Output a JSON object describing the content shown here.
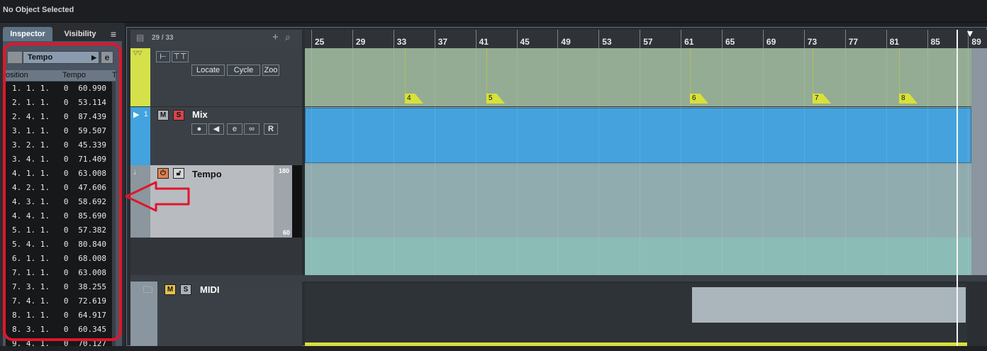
{
  "status_text": "No Object Selected",
  "inspector": {
    "tab_inspector": "Inspector",
    "tab_visibility": "Visibility",
    "menu_icon": "≡",
    "track_select": "Tempo",
    "col_position": "osition",
    "col_tempo": "Tempo",
    "col_extra": "T",
    "rows": [
      {
        "pos": "1. 1. 1.   0",
        "tempo": "60.990"
      },
      {
        "pos": "2. 1. 1.   0",
        "tempo": "53.114"
      },
      {
        "pos": "2. 4. 1.   0",
        "tempo": "87.439"
      },
      {
        "pos": "3. 1. 1.   0",
        "tempo": "59.507"
      },
      {
        "pos": "3. 2. 1.   0",
        "tempo": "45.339"
      },
      {
        "pos": "3. 4. 1.   0",
        "tempo": "71.409"
      },
      {
        "pos": "4. 1. 1.   0",
        "tempo": "63.008"
      },
      {
        "pos": "4. 2. 1.   0",
        "tempo": "47.606"
      },
      {
        "pos": "4. 3. 1.   0",
        "tempo": "58.692"
      },
      {
        "pos": "4. 4. 1.   0",
        "tempo": "85.690"
      },
      {
        "pos": "5. 1. 1.   0",
        "tempo": "57.382"
      },
      {
        "pos": "5. 4. 1.   0",
        "tempo": "80.840"
      },
      {
        "pos": "6. 1. 1.   0",
        "tempo": "68.008"
      },
      {
        "pos": "7. 1. 1.   0",
        "tempo": "63.008"
      },
      {
        "pos": "7. 3. 1.   0",
        "tempo": "38.255"
      },
      {
        "pos": "7. 4. 1.   0",
        "tempo": "72.619"
      },
      {
        "pos": "8. 1. 1.   0",
        "tempo": "64.917"
      },
      {
        "pos": "8. 3. 1.   0",
        "tempo": "60.345"
      },
      {
        "pos": "9. 4. 1.   0",
        "tempo": "70.127"
      }
    ]
  },
  "project": {
    "track_count": "29 / 33",
    "ruler_labels": [
      "25",
      "29",
      "33",
      "37",
      "41",
      "45",
      "49",
      "53",
      "57",
      "61",
      "65",
      "69",
      "73",
      "77",
      "81",
      "85",
      "89"
    ],
    "marker_buttons": {
      "locate": "Locate",
      "cycle": "Cycle",
      "zoom": "Zoo"
    },
    "markers": [
      "4",
      "5",
      "6",
      "7",
      "8"
    ],
    "mix": {
      "number": "1",
      "name": "Mix",
      "mute": "M",
      "solo": "S",
      "read": "R"
    },
    "tempo": {
      "name": "Tempo",
      "range_max": "180",
      "range_min": "60"
    },
    "midi": {
      "name": "MIDI",
      "mute": "M",
      "solo": "S"
    }
  },
  "colors": {
    "accent": "#e0162b",
    "marker_yellow": "#d8e03a",
    "mix_blue": "#42a3de"
  }
}
